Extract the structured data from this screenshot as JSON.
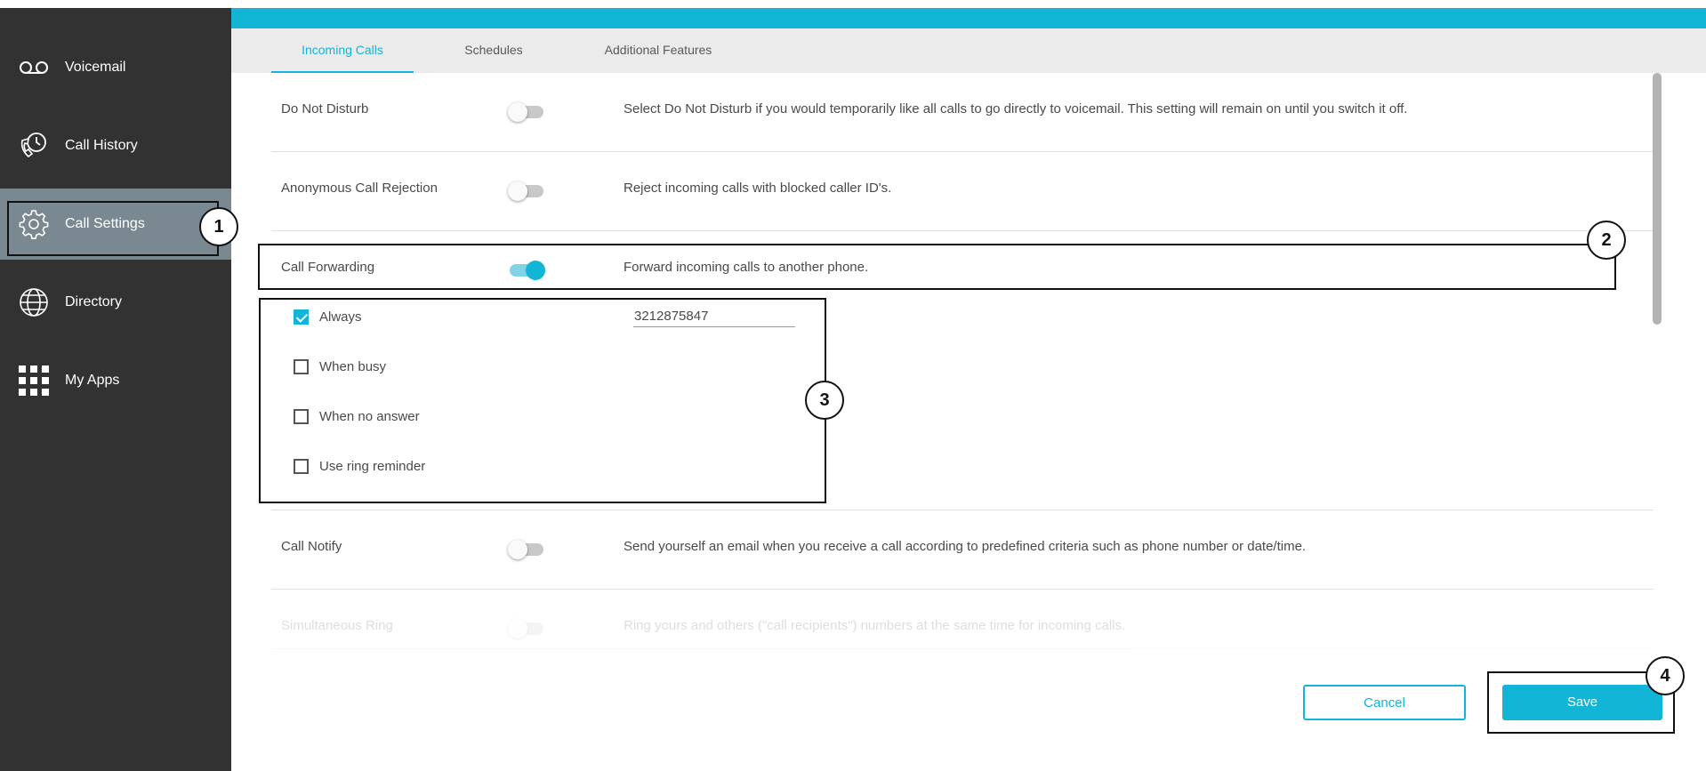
{
  "sidebar": {
    "items": [
      {
        "label": "Voicemail",
        "icon": "voicemail-icon"
      },
      {
        "label": "Call History",
        "icon": "call-history-icon"
      },
      {
        "label": "Call Settings",
        "icon": "gear-icon",
        "active": true
      },
      {
        "label": "Directory",
        "icon": "globe-icon"
      },
      {
        "label": "My Apps",
        "icon": "apps-grid-icon"
      }
    ]
  },
  "tabs": [
    {
      "label": "Incoming Calls",
      "active": true
    },
    {
      "label": "Schedules"
    },
    {
      "label": "Additional Features"
    }
  ],
  "settings": {
    "dnd": {
      "label": "Do Not Disturb",
      "enabled": false,
      "description": "Select Do Not Disturb if you would temporarily like all calls to go directly to voicemail. This setting will remain on until you switch it off."
    },
    "acr": {
      "label": "Anonymous Call Rejection",
      "enabled": false,
      "description": "Reject incoming calls with blocked caller ID's."
    },
    "forwarding": {
      "label": "Call Forwarding",
      "enabled": true,
      "description": "Forward incoming calls to another phone."
    },
    "notify": {
      "label": "Call Notify",
      "enabled": false,
      "description": "Send yourself an email when you receive a call according to predefined criteria such as phone number or date/time."
    },
    "simring": {
      "label": "Simultaneous Ring",
      "enabled": false,
      "description": "Ring yours and others (\"call recipients\") numbers at the same time for incoming calls."
    }
  },
  "forward_options": {
    "always": {
      "label": "Always",
      "checked": true
    },
    "busy": {
      "label": "When busy",
      "checked": false
    },
    "no_answer": {
      "label": "When no answer",
      "checked": false
    },
    "ring_reminder": {
      "label": "Use ring reminder",
      "checked": false
    },
    "number": "3212875847"
  },
  "actions": {
    "cancel": "Cancel",
    "save": "Save"
  },
  "annotations": [
    "1",
    "2",
    "3",
    "4"
  ],
  "colors": {
    "accent": "#12b5d6",
    "sidebar": "#323232",
    "sidebar_active": "#7a8891"
  }
}
